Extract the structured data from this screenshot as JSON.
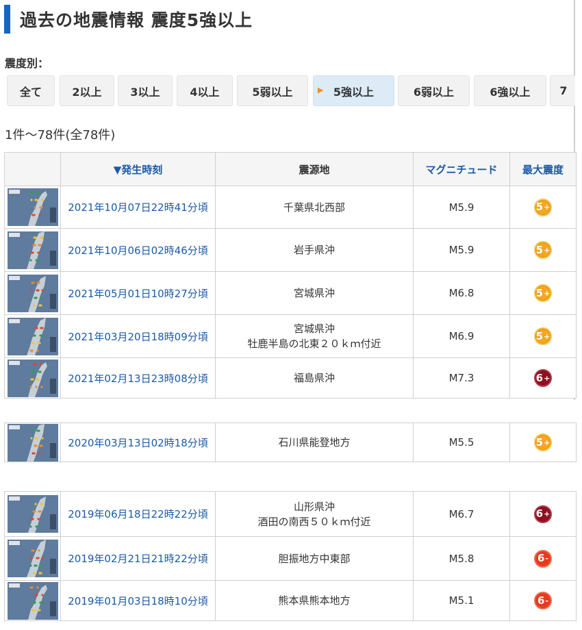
{
  "page": {
    "title": "過去の地震情報 震度5強以上"
  },
  "filter": {
    "label": "震度別：",
    "buttons": [
      "全て",
      "2以上",
      "3以上",
      "4以上",
      "5弱以上",
      "5強以上",
      "6弱以上",
      "6強以上",
      "7"
    ],
    "active": "5強以上"
  },
  "count": "1件～78件(全78件)",
  "table": {
    "headers": {
      "time": "▼発生時刻",
      "location": "震源地",
      "magnitude": "マグニチュード",
      "intensity": "最大震度"
    },
    "groups": [
      {
        "rows": [
          {
            "date": "2021年10月07日22時41分頃",
            "loc1": "千葉県北西部",
            "loc2": "",
            "mag": "M5.9",
            "intensity": "5+"
          },
          {
            "date": "2021年10月06日02時46分頃",
            "loc1": "岩手県沖",
            "loc2": "",
            "mag": "M5.9",
            "intensity": "5+"
          },
          {
            "date": "2021年05月01日10時27分頃",
            "loc1": "宮城県沖",
            "loc2": "",
            "mag": "M6.8",
            "intensity": "5+"
          },
          {
            "date": "2021年03月20日18時09分頃",
            "loc1": "宮城県沖",
            "loc2": "牡鹿半島の北東２０ｋｍ付近",
            "mag": "M6.9",
            "intensity": "5+"
          },
          {
            "date": "2021年02月13日23時08分頃",
            "loc1": "福島県沖",
            "loc2": "",
            "mag": "M7.3",
            "intensity": "6+"
          }
        ]
      },
      {
        "rows": [
          {
            "date": "2020年03月13日02時18分頃",
            "loc1": "石川県能登地方",
            "loc2": "",
            "mag": "M5.5",
            "intensity": "5+"
          }
        ]
      },
      {
        "rows": [
          {
            "date": "2019年06月18日22時22分頃",
            "loc1": "山形県沖",
            "loc2": "酒田の南西５０ｋｍ付近",
            "mag": "M6.7",
            "intensity": "6+"
          },
          {
            "date": "2019年02月21日21時22分頃",
            "loc1": "胆振地方中東部",
            "loc2": "",
            "mag": "M5.8",
            "intensity": "6-"
          },
          {
            "date": "2019年01月03日18時10分頃",
            "loc1": "熊本県熊本地方",
            "loc2": "",
            "mag": "M5.1",
            "intensity": "6-"
          }
        ]
      }
    ]
  },
  "colors": {
    "accent": "#1565c0",
    "link": "#1a5aa6",
    "intensity_5plus": "#f5a623",
    "intensity_6plus": "#8b1020",
    "intensity_6minus": "#e63a1f"
  },
  "icons": {
    "thumbnail": "earthquake-map-thumbnail",
    "badge": "intensity-badge"
  }
}
